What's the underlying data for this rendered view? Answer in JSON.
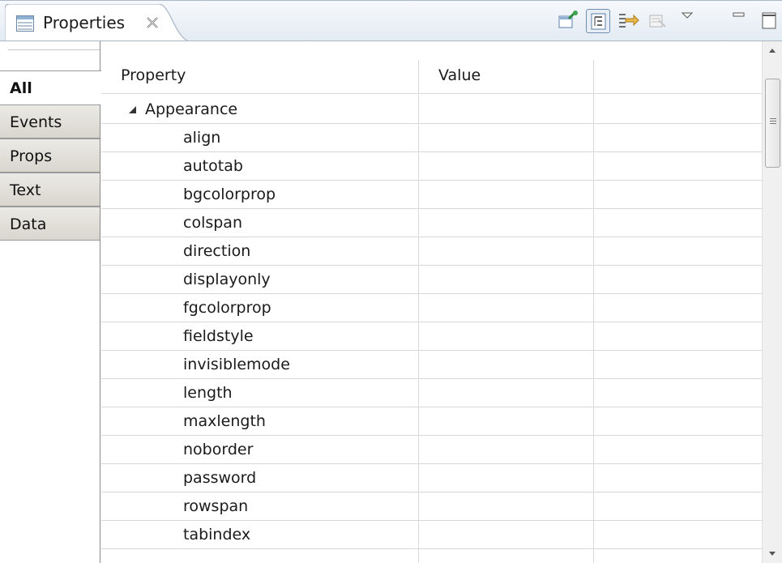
{
  "view": {
    "title": "Properties",
    "close_icon": "close-icon"
  },
  "toolbar": {
    "buttons": [
      {
        "name": "pin-to-selection-button",
        "icon": "pin-icon"
      },
      {
        "name": "show-categories-button",
        "icon": "tree-icon",
        "pressed": true
      },
      {
        "name": "show-advanced-button",
        "icon": "filter-icon"
      },
      {
        "name": "restore-default-button",
        "icon": "restore-icon",
        "disabled": true
      },
      {
        "name": "view-menu-button",
        "icon": "chevron-down-icon"
      },
      {
        "name": "minimize-button",
        "icon": "minimize-icon"
      },
      {
        "name": "maximize-button",
        "icon": "maximize-icon"
      }
    ]
  },
  "sidebar": {
    "tabs": [
      {
        "label": "All",
        "active": true
      },
      {
        "label": "Events"
      },
      {
        "label": "Props"
      },
      {
        "label": "Text"
      },
      {
        "label": "Data"
      }
    ]
  },
  "table": {
    "columns": [
      "Property",
      "Value",
      ""
    ],
    "category": {
      "label": "Appearance",
      "expanded": true
    },
    "rows": [
      "align",
      "autotab",
      "bgcolorprop",
      "colspan",
      "direction",
      "displayonly",
      "fgcolorprop",
      "fieldstyle",
      "invisiblemode",
      "length",
      "maxlength",
      "noborder",
      "password",
      "rowspan",
      "tabindex"
    ]
  },
  "colors": {
    "titlebar_bg": "#e3ebf3",
    "sidetab_bg": "#d9d6ce",
    "grid_line": "#d8d8d8"
  }
}
